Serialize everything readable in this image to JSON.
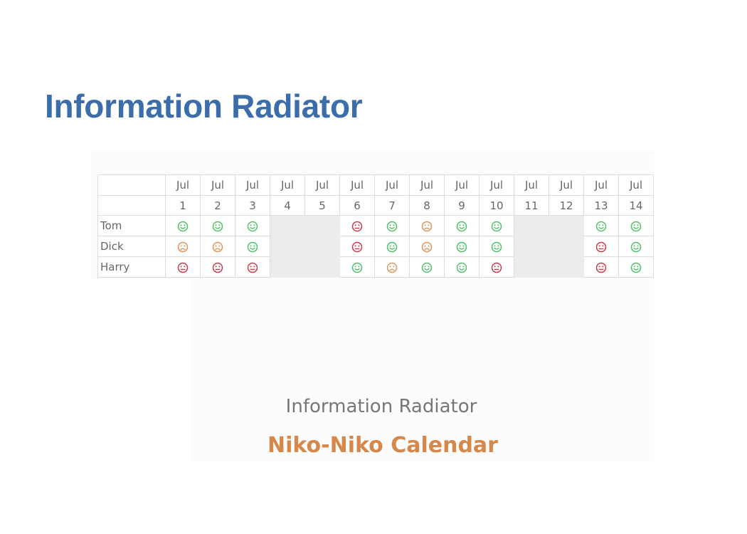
{
  "slide": {
    "title": "Information Radiator"
  },
  "calendar": {
    "month_labels": [
      "Jul",
      "Jul",
      "Jul",
      "Jul",
      "Jul",
      "Jul",
      "Jul",
      "Jul",
      "Jul",
      "Jul",
      "Jul",
      "Jul",
      "Jul",
      "Jul"
    ],
    "days": [
      "1",
      "2",
      "3",
      "4",
      "5",
      "6",
      "7",
      "8",
      "9",
      "10",
      "11",
      "12",
      "13",
      "14"
    ],
    "rows": [
      {
        "name": "Tom",
        "moods": [
          "happy",
          "happy",
          "happy",
          "none",
          "none",
          "unhappy",
          "happy",
          "neutral",
          "happy",
          "happy",
          "none",
          "none",
          "happy",
          "happy"
        ]
      },
      {
        "name": "Dick",
        "moods": [
          "neutral",
          "neutral",
          "happy",
          "none",
          "none",
          "unhappy",
          "happy",
          "neutral",
          "happy",
          "happy",
          "none",
          "none",
          "unhappy",
          "happy"
        ]
      },
      {
        "name": "Harry",
        "moods": [
          "unhappy",
          "unhappy",
          "unhappy",
          "none",
          "none",
          "happy",
          "neutral",
          "happy",
          "happy",
          "unhappy",
          "none",
          "none",
          "unhappy",
          "happy"
        ]
      }
    ],
    "mood_colors": {
      "happy": "#4fc06a",
      "neutral": "#e0935a",
      "unhappy": "#c93a4a"
    },
    "icons": {
      "happy": "smiling-face-icon",
      "neutral": "frowning-face-icon",
      "unhappy": "straight-face-icon"
    }
  },
  "caption": {
    "subtitle": "Information Radiator",
    "title": "Niko-Niko Calendar"
  }
}
